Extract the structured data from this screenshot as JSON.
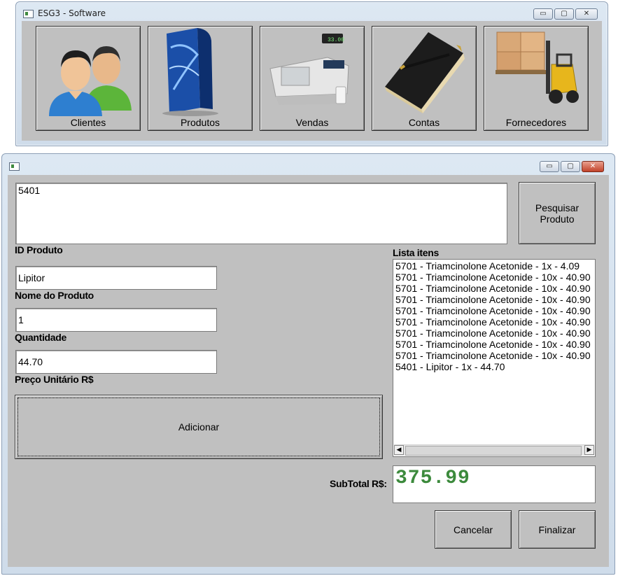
{
  "main_window": {
    "title": "ESG3 - Software",
    "caption_buttons": {
      "minimize": "▭",
      "maximize": "▢",
      "close": "✕"
    },
    "menu_tiles": [
      {
        "label": "Clientes",
        "icon": "users-icon"
      },
      {
        "label": "Produtos",
        "icon": "product-box-icon"
      },
      {
        "label": "Vendas",
        "icon": "cash-register-icon"
      },
      {
        "label": "Contas",
        "icon": "ledger-book-icon"
      },
      {
        "label": "Fornecedores",
        "icon": "forklift-icon"
      }
    ]
  },
  "sales_window": {
    "title": "",
    "caption_buttons": {
      "minimize": "▭",
      "maximize": "▢",
      "close": "✕"
    },
    "search_value": "5401",
    "search_button": "Pesquisar Produto",
    "labels": {
      "id_produto": "ID Produto",
      "nome_produto": "Nome do Produto",
      "quantidade": "Quantidade",
      "preco_unitario": "Preço Unitário R$",
      "lista_itens": "Lista itens",
      "subtotal": "SubTotal R$:"
    },
    "fields": {
      "product_name": "Lipitor",
      "quantity": "1",
      "unit_price": "44.70"
    },
    "add_button": "Adicionar",
    "items": [
      "5701 - Triamcinolone Acetonide - 1x - 4.09",
      "5701 - Triamcinolone Acetonide - 10x - 40.90",
      "5701 - Triamcinolone Acetonide - 10x - 40.90",
      "5701 - Triamcinolone Acetonide - 10x - 40.90",
      "5701 - Triamcinolone Acetonide - 10x - 40.90",
      "5701 - Triamcinolone Acetonide - 10x - 40.90",
      "5701 - Triamcinolone Acetonide - 10x - 40.90",
      "5701 - Triamcinolone Acetonide - 10x - 40.90",
      "5701 - Triamcinolone Acetonide - 10x - 40.90",
      "5401 - Lipitor - 1x - 44.70"
    ],
    "scroll_left": "◀",
    "scroll_right": "▶",
    "subtotal_value": "375.99",
    "subtotal_color": "#3c8a3c",
    "cancel_button": "Cancelar",
    "finish_button": "Finalizar"
  }
}
